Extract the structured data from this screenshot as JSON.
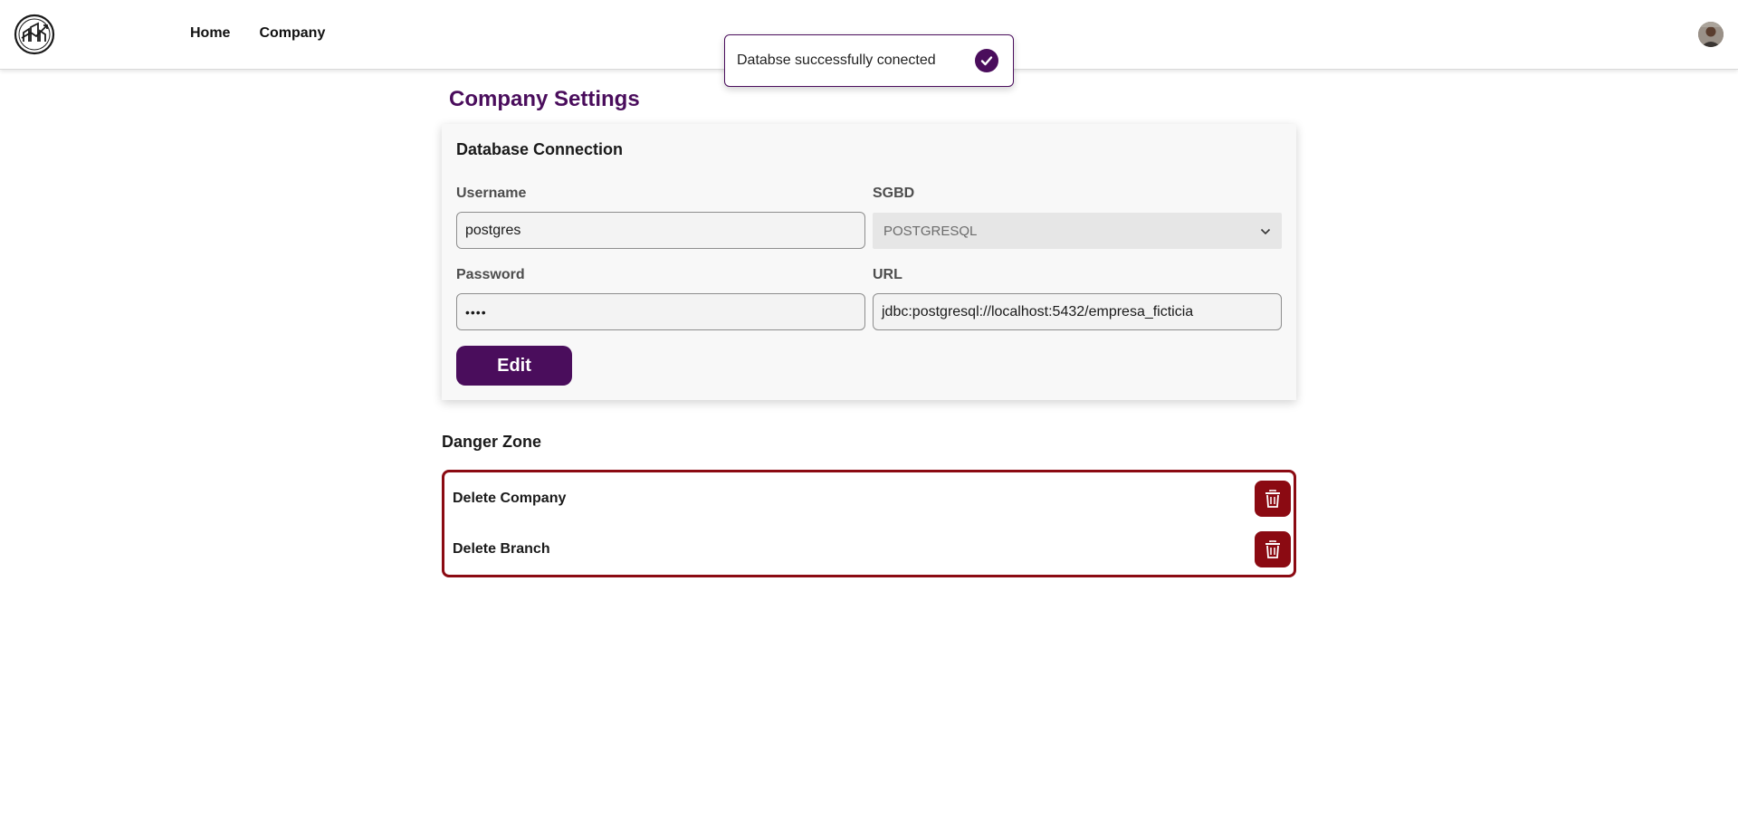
{
  "nav": {
    "links": [
      "Home",
      "Company"
    ]
  },
  "toast": {
    "message": "Databse successfully conected"
  },
  "page": {
    "title": "Company Settings"
  },
  "db_connection": {
    "title": "Database Connection",
    "username_label": "Username",
    "username_value": "postgres",
    "password_label": "Password",
    "password_value": "••••",
    "sgbd_label": "SGBD",
    "sgbd_selected": "POSTGRESQL",
    "url_label": "URL",
    "url_value": "jdbc:postgresql://localhost:5432/empresa_ficticia",
    "edit_label": "Edit"
  },
  "danger_zone": {
    "title": "Danger Zone",
    "items": [
      "Delete Company",
      "Delete Branch"
    ]
  },
  "colors": {
    "primary": "#4a0d5c",
    "danger": "#8b0a12"
  }
}
